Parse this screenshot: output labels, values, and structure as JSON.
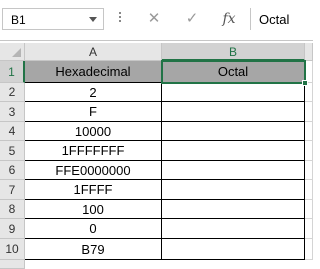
{
  "formula_bar": {
    "name_box": "B1",
    "cancel_glyph": "✕",
    "enter_glyph": "✓",
    "fx_glyph": "fx",
    "formula": "Octal"
  },
  "sheet": {
    "corner_icon": "select-all-triangle",
    "columns": [
      "A",
      "B"
    ],
    "rows": [
      "1",
      "2",
      "3",
      "4",
      "5",
      "6",
      "7",
      "8",
      "9",
      "10"
    ],
    "selected_cell": "B1",
    "header_fill": "#a6a6a6",
    "selection_color": "#217346",
    "col_a": [
      "Hexadecimal",
      "2",
      "F",
      "10000",
      "1FFFFFFF",
      "FFE0000000",
      "1FFFF",
      "100",
      "0",
      "B79"
    ],
    "col_b": [
      "Octal",
      "",
      "",
      "",
      "",
      "",
      "",
      "",
      "",
      ""
    ]
  }
}
